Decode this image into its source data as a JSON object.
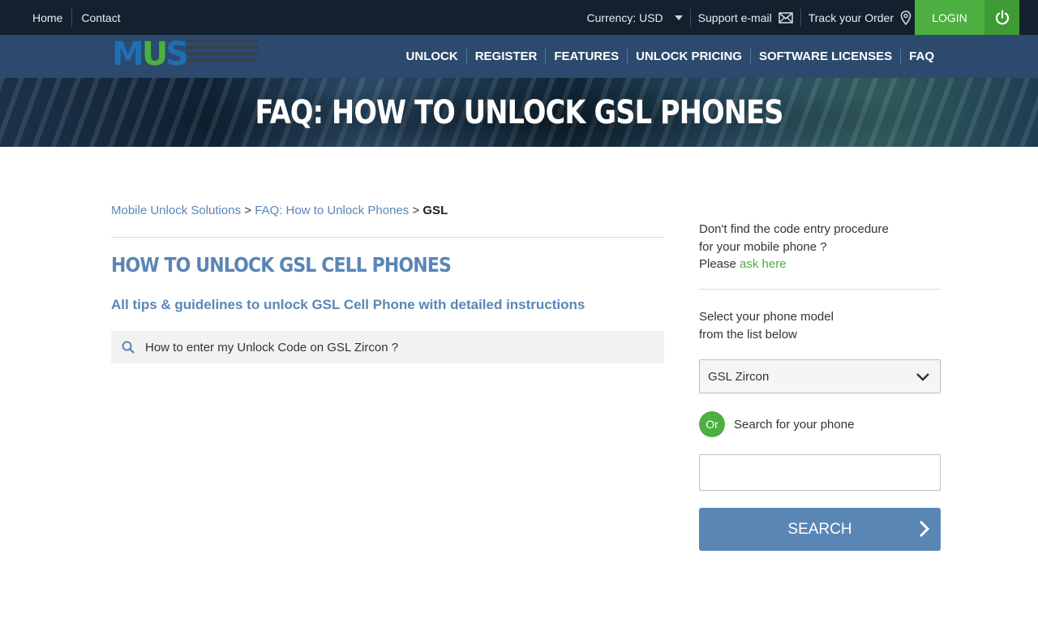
{
  "topbar": {
    "home_label": "Home",
    "contact_label": "Contact",
    "currency_label": "Currency: USD",
    "support_label": "Support e-mail",
    "track_label": "Track your Order",
    "login_label": "LOGIN",
    "icons": [
      "caret-down-icon",
      "mail-icon",
      "map-pin-icon",
      "power-icon"
    ]
  },
  "navbar": {
    "logo": {
      "letters": [
        "M",
        "U",
        "S"
      ]
    },
    "items": [
      "UNLOCK",
      "REGISTER",
      "FEATURES",
      "UNLOCK PRICING",
      "SOFTWARE LICENSES",
      "FAQ"
    ]
  },
  "hero": {
    "title": "FAQ: HOW TO UNLOCK GSL PHONES"
  },
  "breadcrumb": {
    "items": [
      "Mobile Unlock Solutions",
      "FAQ: How to Unlock Phones"
    ],
    "separator": ">",
    "current": "GSL"
  },
  "main": {
    "title": "HOW TO UNLOCK GSL CELL PHONES",
    "subtitle": "All tips & guidelines to unlock GSL Cell Phone with detailed instructions",
    "faq_items": [
      "How to enter my Unlock Code on GSL Zircon ?"
    ]
  },
  "sidebar": {
    "help_line1": "Don't find the code entry procedure",
    "help_line2": "for your mobile phone ?",
    "help_line3_prefix": "Please",
    "ask_link": "ask here",
    "select_line1": "Select your phone model",
    "select_line2": "from the list below",
    "selected_model": "GSL Zircon",
    "or_badge": "Or",
    "or_label": "Search for your phone",
    "search_value": "",
    "search_button": "SEARCH"
  },
  "colors": {
    "topbar_bg": "#13202e",
    "navbar_bg": "#2c4a6d",
    "accent_blue": "#5a86b5",
    "accent_green": "#4caf3f"
  }
}
